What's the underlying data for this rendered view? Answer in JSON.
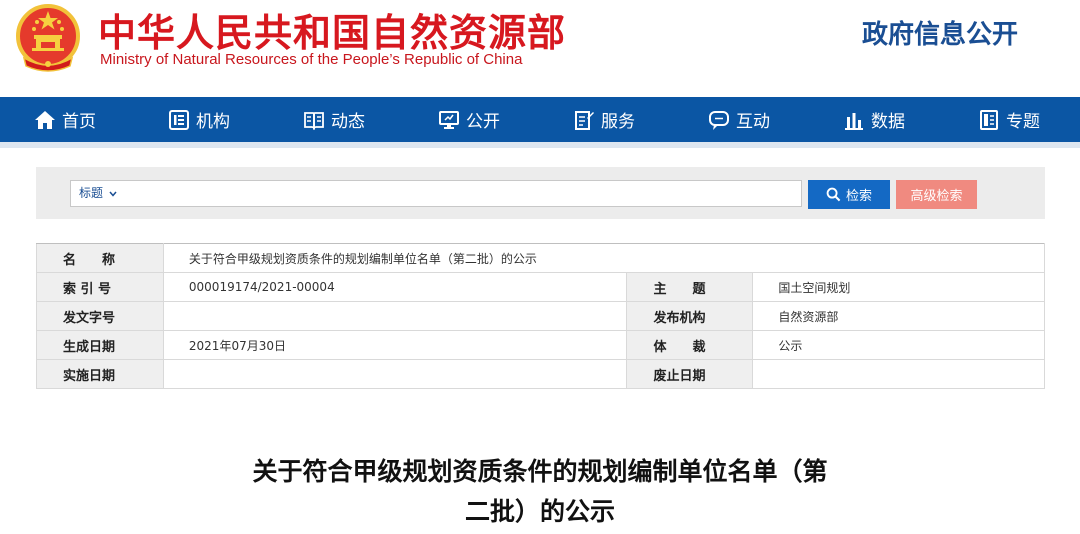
{
  "header": {
    "site_name_cn": "中华人民共和国自然资源部",
    "site_name_en": "Ministry of Natural Resources of the People’s Republic of China",
    "gov_info_open": "政府信息公开",
    "brand_red": "#d7181f",
    "brand_blue": "#1a4e93"
  },
  "nav": {
    "color": "#0b56a4",
    "items": [
      {
        "label": "首页",
        "icon": "home-icon"
      },
      {
        "label": "机构",
        "icon": "organization-icon"
      },
      {
        "label": "动态",
        "icon": "book-icon"
      },
      {
        "label": "公开",
        "icon": "monitor-icon"
      },
      {
        "label": "服务",
        "icon": "document-edit-icon"
      },
      {
        "label": "互动",
        "icon": "chat-icon"
      },
      {
        "label": "数据",
        "icon": "bar-chart-icon"
      },
      {
        "label": "专题",
        "icon": "topic-icon"
      }
    ]
  },
  "search": {
    "scope": "标题",
    "placeholder": "",
    "search_label": "检索",
    "advanced_label": "高级检索"
  },
  "info": {
    "name_label": "名　　称",
    "name_value": "关于符合甲级规划资质条件的规划编制单位名单（第二批）的公示",
    "index_label": "索 引 号",
    "index_value": "000019174/2021-00004",
    "subject_label": "主　　题",
    "subject_value": "国土空间规划",
    "doc_no_label": "发文字号",
    "doc_no_value": "",
    "publisher_label": "发布机构",
    "publisher_value": "自然资源部",
    "date_label": "生成日期",
    "date_value": "2021年07月30日",
    "genre_label": "体　　裁",
    "genre_value": "公示",
    "effective_label": "实施日期",
    "effective_value": "",
    "expiry_label": "废止日期",
    "expiry_value": ""
  },
  "article": {
    "title_line1": "关于符合甲级规划资质条件的规划编制单位名单（第",
    "title_line2": "二批）的公示"
  }
}
